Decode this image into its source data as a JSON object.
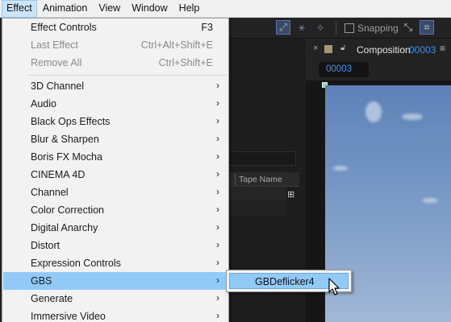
{
  "menubar": {
    "items": [
      "Effect",
      "Animation",
      "View",
      "Window",
      "Help"
    ]
  },
  "toolbar": {
    "snapping_label": "Snapping"
  },
  "project_panel": {
    "column_header": "Tape Name"
  },
  "composition": {
    "tab_label": "Composition",
    "tab_name": "00003",
    "name_pill": "00003",
    "menu_glyph": "≡"
  },
  "effect_menu": {
    "items": [
      {
        "label": "Effect Controls",
        "shortcut": "F3",
        "disabled": false,
        "submenu": false
      },
      {
        "label": "Last Effect",
        "shortcut": "Ctrl+Alt+Shift+E",
        "disabled": true,
        "submenu": false
      },
      {
        "label": "Remove All",
        "shortcut": "Ctrl+Shift+E",
        "disabled": true,
        "submenu": false
      },
      {
        "label": "3D Channel",
        "submenu": true
      },
      {
        "label": "Audio",
        "submenu": true
      },
      {
        "label": "Black Ops Effects",
        "submenu": true
      },
      {
        "label": "Blur & Sharpen",
        "submenu": true
      },
      {
        "label": "Boris FX Mocha",
        "submenu": true
      },
      {
        "label": "CINEMA 4D",
        "submenu": true
      },
      {
        "label": "Channel",
        "submenu": true
      },
      {
        "label": "Color Correction",
        "submenu": true
      },
      {
        "label": "Digital Anarchy",
        "submenu": true
      },
      {
        "label": "Distort",
        "submenu": true
      },
      {
        "label": "Expression Controls",
        "submenu": true
      },
      {
        "label": "GBS",
        "submenu": true,
        "highlighted": true
      },
      {
        "label": "Generate",
        "submenu": true
      },
      {
        "label": "Immersive Video",
        "submenu": true
      }
    ]
  },
  "gbs_submenu": {
    "items": [
      "GBDeflicker4"
    ]
  },
  "colors": {
    "menu_highlight": "#91c9f7",
    "accent_blue": "#3b8ff0"
  }
}
